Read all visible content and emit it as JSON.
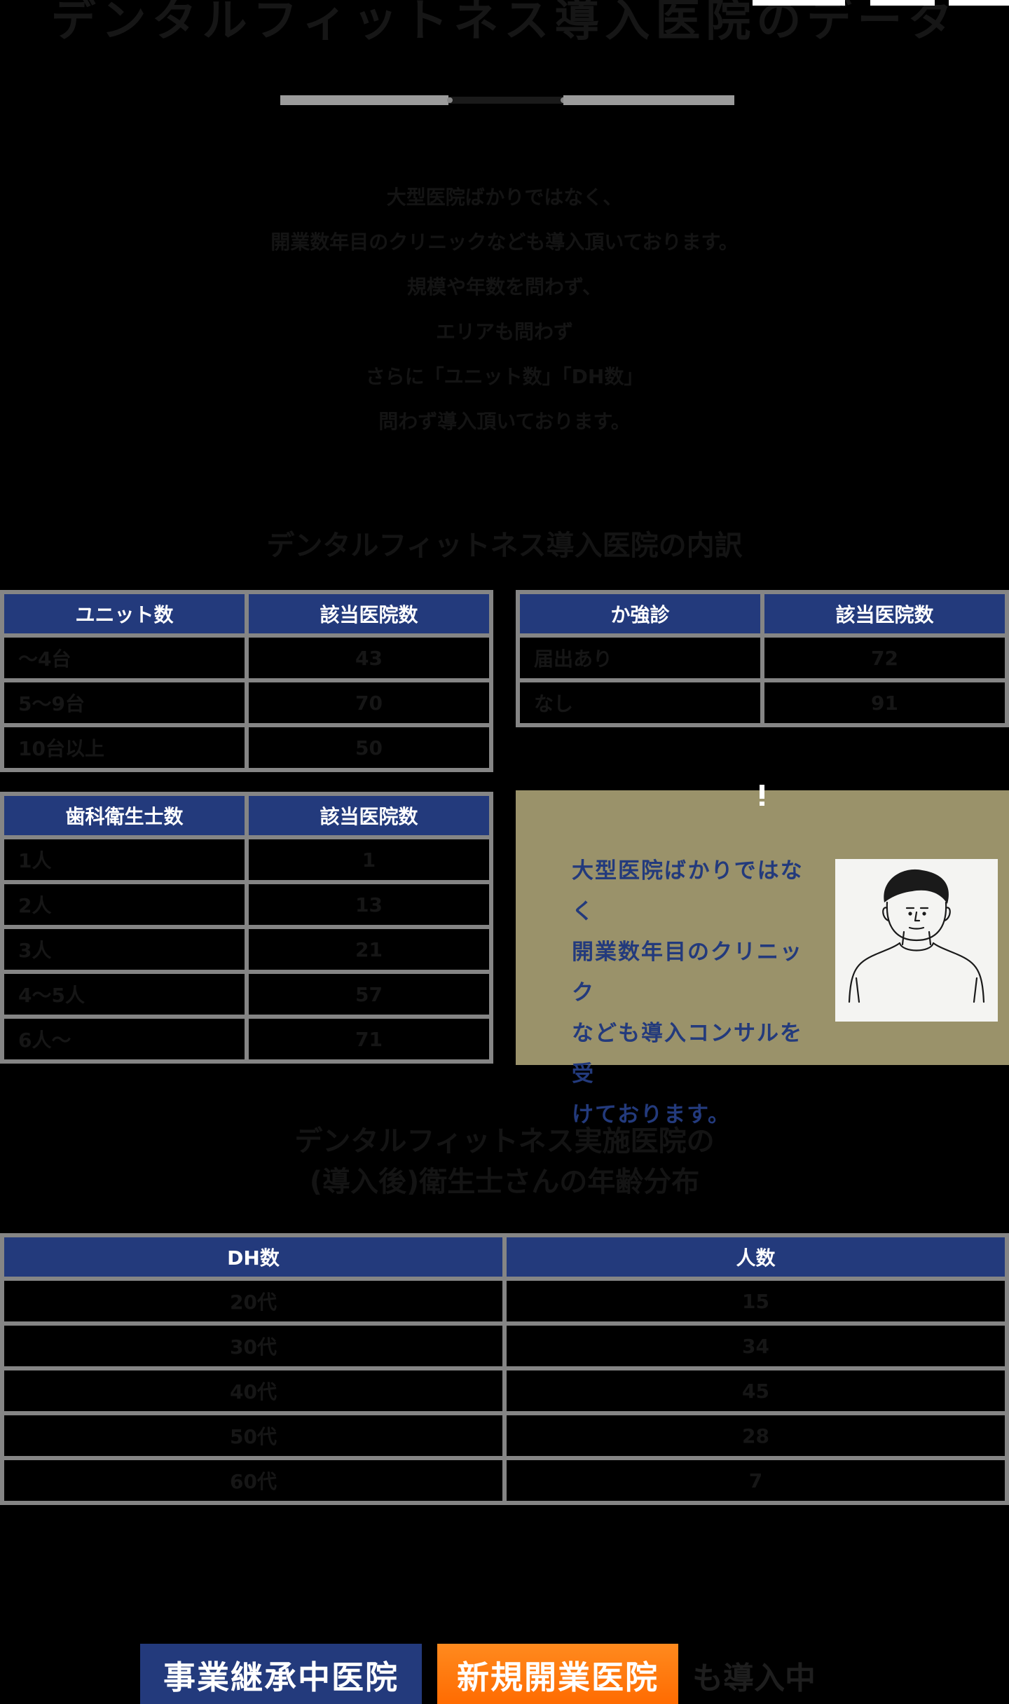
{
  "header": {
    "title": "デンタルフィットネス導入医院のデータ"
  },
  "intro": {
    "lines": [
      "大型医院ばかりではなく、",
      "開業数年目のクリニックなども導入頂いております。",
      "規模や年数を問わず、",
      "エリアも問わず",
      "さらに「ユニット数」「DH数」",
      "問わず導入頂いております。"
    ]
  },
  "section1": {
    "title": "デンタルフィットネス導入医院の内訳"
  },
  "units_table": {
    "headers": [
      "ユニット数",
      "該当医院数"
    ],
    "rows": [
      [
        "～4台",
        "43"
      ],
      [
        "5～9台",
        "70"
      ],
      [
        "10台以上",
        "50"
      ]
    ]
  },
  "kakyoshin_table": {
    "headers": [
      "か強診",
      "該当医院数"
    ],
    "rows": [
      [
        "届出あり",
        "72"
      ],
      [
        "なし",
        "91"
      ]
    ]
  },
  "dh_table": {
    "headers": [
      "歯科衛生士数",
      "該当医院数"
    ],
    "rows": [
      [
        "1人",
        "1"
      ],
      [
        "2人",
        "13"
      ],
      [
        "3人",
        "21"
      ],
      [
        "4～5人",
        "57"
      ],
      [
        "6人～",
        "71"
      ]
    ]
  },
  "promo": {
    "lines": [
      "大型医院ばかりではなく",
      "開業数年目のクリニック",
      "なども導入コンサルを受",
      "けております。"
    ],
    "avatar_icon": "person-illustration-icon"
  },
  "section2": {
    "title_lines": [
      "デンタルフィットネス実施医院の",
      "(導入後)衛生士さんの年齢分布"
    ]
  },
  "age_table": {
    "headers": [
      "DH数",
      "人数"
    ],
    "rows": [
      [
        "20代",
        "15"
      ],
      [
        "30代",
        "34"
      ],
      [
        "40代",
        "45"
      ],
      [
        "50代",
        "28"
      ],
      [
        "60代",
        "7"
      ]
    ]
  },
  "badges": {
    "succession": "事業継承中医院",
    "new_opening": "新規開業医院",
    "tail": "も導入中"
  },
  "colors": {
    "navy": "#233a7c",
    "orange": "#ff7a10",
    "khaki": "#9a926a",
    "grid": "#858585"
  }
}
